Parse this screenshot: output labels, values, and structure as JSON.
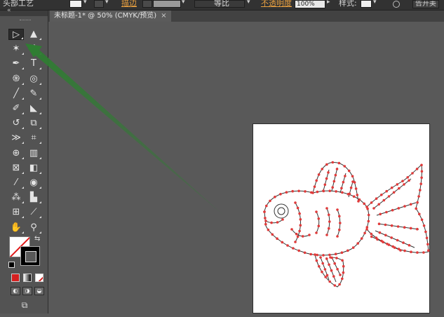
{
  "control_bar": {
    "workspace_label": "头部工艺",
    "stroke_label": "描边",
    "stroke_style": "等比",
    "opacity_label": "不透明度",
    "opacity_value": "100%",
    "style_label": "样式:",
    "right_button": "告开美"
  },
  "document": {
    "tab_title": "未标题-1* @ 50% (CMYK/预览)",
    "tab_close": "×"
  },
  "tools": [
    {
      "id": "selection-tool",
      "glyph": "▷",
      "active": true
    },
    {
      "id": "direct-selection-tool",
      "glyph": "▲"
    },
    {
      "id": "magic-wand-tool",
      "glyph": "✶"
    },
    {
      "id": "lasso-tool",
      "glyph": "ℓ"
    },
    {
      "id": "pen-tool",
      "glyph": "✒"
    },
    {
      "id": "type-tool",
      "glyph": "T"
    },
    {
      "id": "spiral-tool",
      "glyph": "֍"
    },
    {
      "id": "ellipse-tool",
      "glyph": "◎"
    },
    {
      "id": "paintbrush-tool",
      "glyph": "╱"
    },
    {
      "id": "pencil-tool",
      "glyph": "✎"
    },
    {
      "id": "blob-brush-tool",
      "glyph": "✐"
    },
    {
      "id": "eraser-tool",
      "glyph": "◣"
    },
    {
      "id": "rotate-tool",
      "glyph": "↺"
    },
    {
      "id": "scale-tool",
      "glyph": "⧉"
    },
    {
      "id": "width-tool",
      "glyph": "≫"
    },
    {
      "id": "free-transform-tool",
      "glyph": "⌗"
    },
    {
      "id": "shape-builder-tool",
      "glyph": "⊕"
    },
    {
      "id": "chart-tool",
      "glyph": "▥"
    },
    {
      "id": "mesh-tool",
      "glyph": "⊠"
    },
    {
      "id": "gradient-tool",
      "glyph": "◧"
    },
    {
      "id": "eyedropper-tool",
      "glyph": "⁄"
    },
    {
      "id": "blend-tool",
      "glyph": "◉"
    },
    {
      "id": "symbol-sprayer-tool",
      "glyph": "⁂"
    },
    {
      "id": "column-graph-tool",
      "glyph": "▙"
    },
    {
      "id": "artboard-tool",
      "glyph": "⊞"
    },
    {
      "id": "slice-tool",
      "glyph": "⟋"
    },
    {
      "id": "hand-tool",
      "glyph": "✋"
    },
    {
      "id": "zoom-tool",
      "glyph": "⚲"
    }
  ],
  "colors": {
    "fill": "none",
    "stroke": "#000000",
    "fish_points": "#e03a3a",
    "arrow": "#2f7d32"
  }
}
